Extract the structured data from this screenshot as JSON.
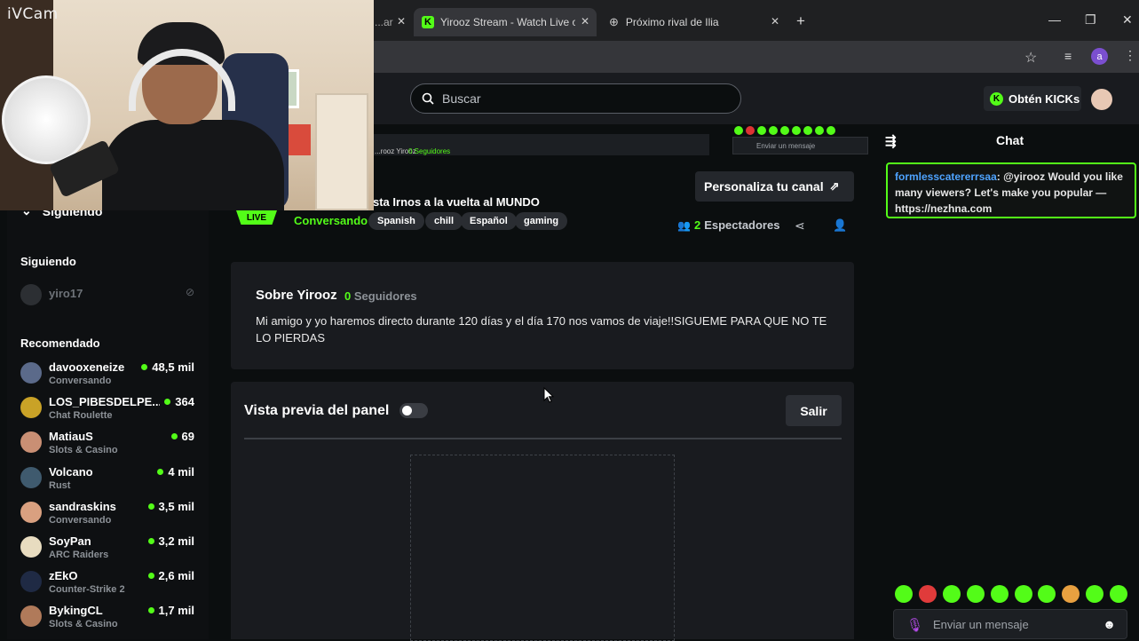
{
  "browser": {
    "tabs": [
      {
        "label": "...ar",
        "close": "✕"
      },
      {
        "label": "Yirooz Stream - Watch Live on K",
        "close": "✕"
      },
      {
        "label": "Próximo rival de Ilia",
        "close": "✕"
      }
    ],
    "new_tab": "+",
    "window_controls": {
      "minimize": "—",
      "restore": "❐",
      "close": "✕"
    },
    "profile_initial": "a"
  },
  "header": {
    "search_placeholder": "Buscar",
    "kicks_button": "Obtén KICKs",
    "kicks_icon_letter": "K"
  },
  "mini_preview": {
    "name": "...rooz Yirooz",
    "followers": "0 Seguidores",
    "chat_placeholder": "Enviar un mensaje"
  },
  "sidebar": {
    "collapse_label": "Siguiendo",
    "following_heading": "Siguiendo",
    "following": [
      {
        "name": "yiro17"
      }
    ],
    "recommended_heading": "Recomendado",
    "recommended": [
      {
        "name": "davooxeneize",
        "category": "Conversando",
        "viewers": "48,5 mil",
        "avatar_color": "#5b6a8a"
      },
      {
        "name": "LOS_PIBESDELPE...",
        "category": "Chat Roulette",
        "viewers": "364",
        "avatar_color": "#c9a227"
      },
      {
        "name": "MatiauS",
        "category": "Slots & Casino",
        "viewers": "69",
        "avatar_color": "#c98f74"
      },
      {
        "name": "Volcano",
        "category": "Rust",
        "viewers": "4 mil",
        "avatar_color": "#3f5a6e"
      },
      {
        "name": "sandraskins",
        "category": "Conversando",
        "viewers": "3,5 mil",
        "avatar_color": "#d9a080"
      },
      {
        "name": "SoyPan",
        "category": "ARC Raiders",
        "viewers": "3,2 mil",
        "avatar_color": "#e8dcc0"
      },
      {
        "name": "zEkO",
        "category": "Counter-Strike 2",
        "viewers": "2,6 mil",
        "avatar_color": "#1f2a44"
      },
      {
        "name": "BykingCL",
        "category": "Slots & Casino",
        "viewers": "1,7 mil",
        "avatar_color": "#b07a5a"
      }
    ]
  },
  "stream": {
    "title": "sta Irnos a la vuelta al MUNDO",
    "live_badge": "LIVE",
    "category": "Conversando",
    "tags": [
      "Spanish",
      "chill",
      "Español",
      "gaming"
    ],
    "customize_button": "Personaliza tu canal",
    "viewers_count": "2",
    "viewers_label": "Espectadores"
  },
  "about": {
    "heading": "Sobre Yirooz",
    "followers_count": "0",
    "followers_label": "Seguidores",
    "bio": "Mi amigo y yo haremos directo durante 120 días y el día 170 nos vamos de viaje!!SIGUEME PARA QUE NO TE LO PIERDAS"
  },
  "panel": {
    "title": "Vista previa del panel",
    "exit_button": "Salir"
  },
  "chat": {
    "title": "Chat",
    "message": {
      "user": "formlesscatererrsaa",
      "text": ": @yirooz Would you like many viewers? Let's make you popular — https://nezhna.com"
    },
    "input_placeholder": "Enviar un mensaje"
  },
  "webcam": {
    "label": "iVCam"
  },
  "colors": {
    "accent": "#53fc18",
    "background": "#0b0e0f",
    "surface": "#191b1f"
  }
}
